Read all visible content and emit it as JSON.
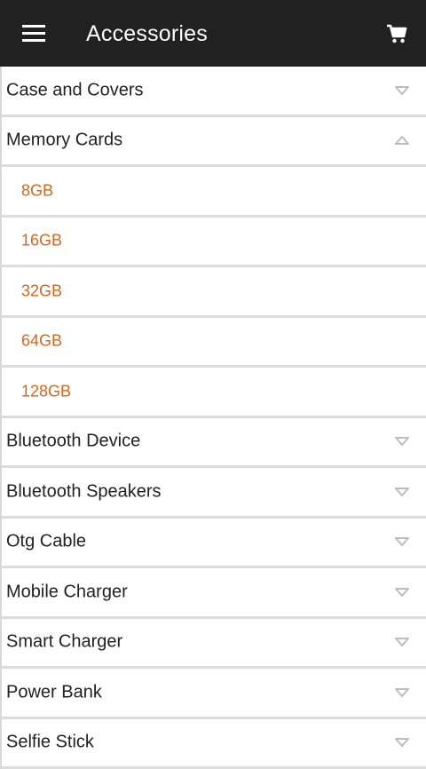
{
  "header": {
    "title": "Accessories",
    "menu_icon": "hamburger-menu-icon",
    "cart_icon": "shopping-cart-icon",
    "background": "#212121"
  },
  "categories": [
    {
      "label": "Case and Covers",
      "expanded": false
    },
    {
      "label": "Memory Cards",
      "expanded": true,
      "children": [
        "8GB",
        "16GB",
        "32GB",
        "64GB",
        "128GB"
      ]
    },
    {
      "label": "Bluetooth Device",
      "expanded": false
    },
    {
      "label": "Bluetooth Speakers",
      "expanded": false
    },
    {
      "label": "Otg Cable",
      "expanded": false
    },
    {
      "label": "Mobile Charger",
      "expanded": false
    },
    {
      "label": "Smart Charger",
      "expanded": false
    },
    {
      "label": "Power Bank",
      "expanded": false
    },
    {
      "label": "Selfie Stick",
      "expanded": false
    }
  ],
  "colors": {
    "subcategory_text": "#d2691e",
    "text": "#212121",
    "divider": "#dcdcdc",
    "chevron": "#bdbdbd"
  }
}
